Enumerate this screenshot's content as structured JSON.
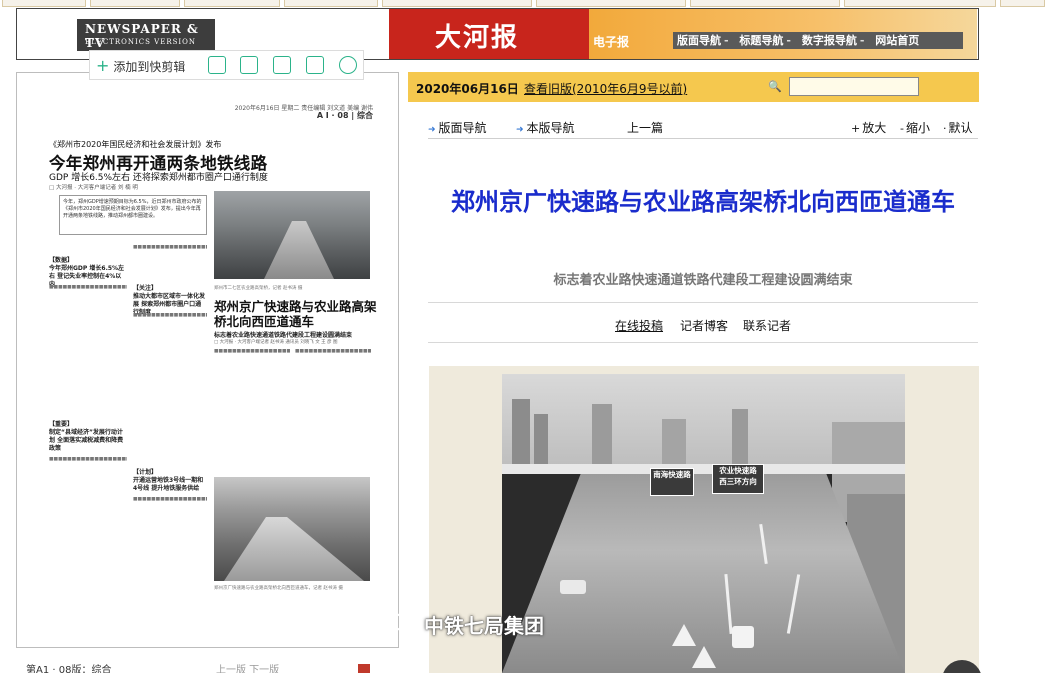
{
  "header": {
    "logo_line1": "NEWSPAPER & TV",
    "logo_line2": "ELECTRONICS VERSION",
    "paper_name": "大河报",
    "epaper_label": "电子报",
    "nav": [
      "版面导航",
      "标题导航",
      "数字报导航",
      "网站首页"
    ]
  },
  "toolbar": {
    "add_label": "添加到快剪辑"
  },
  "newspaper": {
    "meta": "2020年6月16日 星期二 责任编辑 刘文道 美编 谢伟",
    "page_number": "A I · 08 | 综合",
    "kicker": "《郑州市2020年国民经济和社会发展计划》发布",
    "headline": "今年郑州再开通两条地铁线路",
    "subheadline": "GDP 增长6.5%左右  还将探索郑州都市圈产口通行制度",
    "byline": "□ 大河报 · 大河客户端记者 刘 楠 明",
    "lead": "今年，郑州GDP增速预期目标为6.5%，近日郑州市政府公布的《郑州市2020年国民经济和社会发展计划》发布，提出今年再开通两条地铁线路，推动郑州都市圈建设。",
    "mini_heads": [
      "【数据】",
      "今年郑州GDP 增长6.5%左右 登记失业率控制在4%以内",
      "【关注】",
      "推动大都市区域市一体化发展 探索郑州都市圈户口通行制度",
      "【重要】",
      "制定“县域经济”发展行动计划 全面落实减税减费和降费政策",
      "【计划】",
      "开通运营地铁3号线一期和4号线 提升地铁服务供给"
    ],
    "mid_headline": "郑州京广快速路与农业路高架桥北向西匝道通车",
    "mid_sub": "标志着农业路快速通道铁路代建段工程建设圆满结束",
    "mid_byline": "□ 大河报 · 大河客户端记者 赵书涛 通讯员 刘晓飞 文 王 彦 图",
    "caption1": "郑州市二七区农业路高架桥，记者 赵书涛 摄",
    "caption2": "郑州京广快速路与农业路高架桥北向西匝道通车，记者 赵书涛 摄"
  },
  "article_panel": {
    "date": "2020年06月16日",
    "old_edition_link": "查看旧版(2010年6月9号以前)",
    "search_placeholder": "",
    "nav": {
      "page_nav": "版面导航",
      "this_page_nav": "本版导航",
      "prev": "上一篇"
    },
    "zoom": {
      "enlarge": "放大",
      "shrink": "缩小",
      "default": "默认"
    },
    "title": "郑州京广快速路与农业路高架桥北向西匝道通车",
    "subtitle": "标志着农业路快速通道铁路代建段工程建设圆满结束",
    "actions": [
      "在线投稿",
      "记者博客",
      "联系记者"
    ],
    "photo_signs": {
      "left": "南海快速路",
      "right": "农业快速路\n西三环方向"
    },
    "watermark": "中铁七局集团"
  },
  "bottom": {
    "left_text": "第A1 · 08版：综合",
    "middle_text": "上一版  下一版"
  },
  "colors": {
    "title_blue": "#1a2ccc",
    "date_bar": "#f5c84e",
    "banner_red": "#c8251c",
    "accent_green": "#2bb38a"
  }
}
